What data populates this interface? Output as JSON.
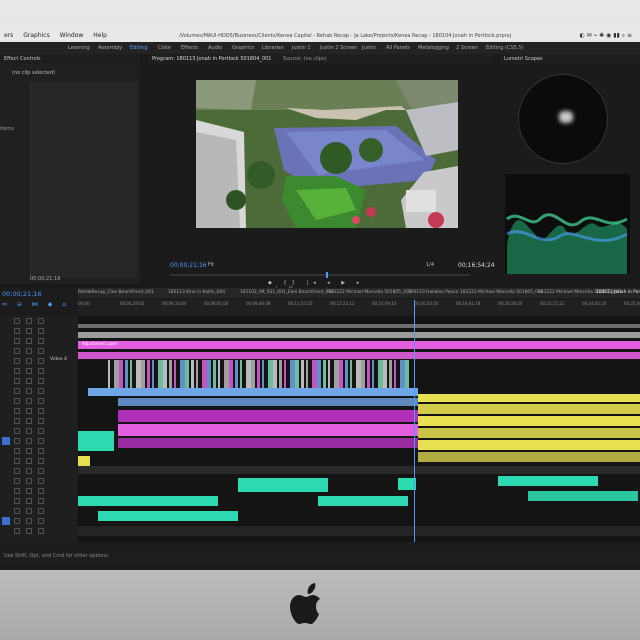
{
  "menubar": {
    "items": [
      "ers",
      "Graphics",
      "Window",
      "Help"
    ],
    "path": "/Volumes/MAUI-HDD5/Business/Clients/Kenea Capital - Rehab Recap - Ja Lake/Projects/Kenea Recap - 180104 Jonah in Portlock.prproj"
  },
  "workspaces": [
    "Learning",
    "Assembly",
    "Editing",
    "Color",
    "Effects",
    "Audio",
    "Graphics",
    "Libraries",
    "Justin 1",
    "Justin 2 Screen",
    "Justin",
    "All Panels",
    "Metalogging",
    "2 Screen",
    "Editing (CS5.5)"
  ],
  "active_workspace": "Editing",
  "effect_controls": {
    "title": "Effect Controls",
    "clip": "(no clip selected)",
    "label": "items",
    "timecode": "00;00;21;16"
  },
  "program": {
    "title": "Program: 180113 Jonah in Portlock 501804_001",
    "source": "Source: (no clips)",
    "timecode": "00;00;21;16",
    "fit": "Fit",
    "fraction": "1/4",
    "duration": "00;16;54;24"
  },
  "scopes": {
    "title": "Lumetri Scopes"
  },
  "timeline": {
    "timecode": "00;00;21;16",
    "tabs": [
      "RehabRecap_Cleo BeachFront_001",
      "180113 Kino in Kalihi_004",
      "181102_99_5S1_001_Eleo BeachFront_003",
      "181222 Michael Marcella 501805_001",
      "190110 Halakea Peace",
      "181222 Michael Marcella 501805_002",
      "181222 Michael Marcella 501805_003",
      "180113 Jonah in Portlock 501804_001"
    ],
    "ruler": [
      "00;00",
      "00;04;29;02",
      "00;06;14;04",
      "00;08;01;06",
      "00;09;48;08",
      "00;11;35;10",
      "00;13;22;12",
      "00;15;09;14",
      "00;16;54;16",
      "00;18;41;18",
      "00;20;28;20",
      "00;22;15;22",
      "00;24;02;24",
      "00;25;49;26"
    ],
    "track_label": "Video 4",
    "adjustment": "Adjustment Layer"
  },
  "status": "Use Shift, Opt, and Cmd for other options.",
  "colors": {
    "accent": "#4a9cff",
    "pink": "#e35fe0",
    "yellow": "#e8e050",
    "teal": "#2dd9b0",
    "blue": "#6fa6e8",
    "magenta": "#b030b8"
  }
}
